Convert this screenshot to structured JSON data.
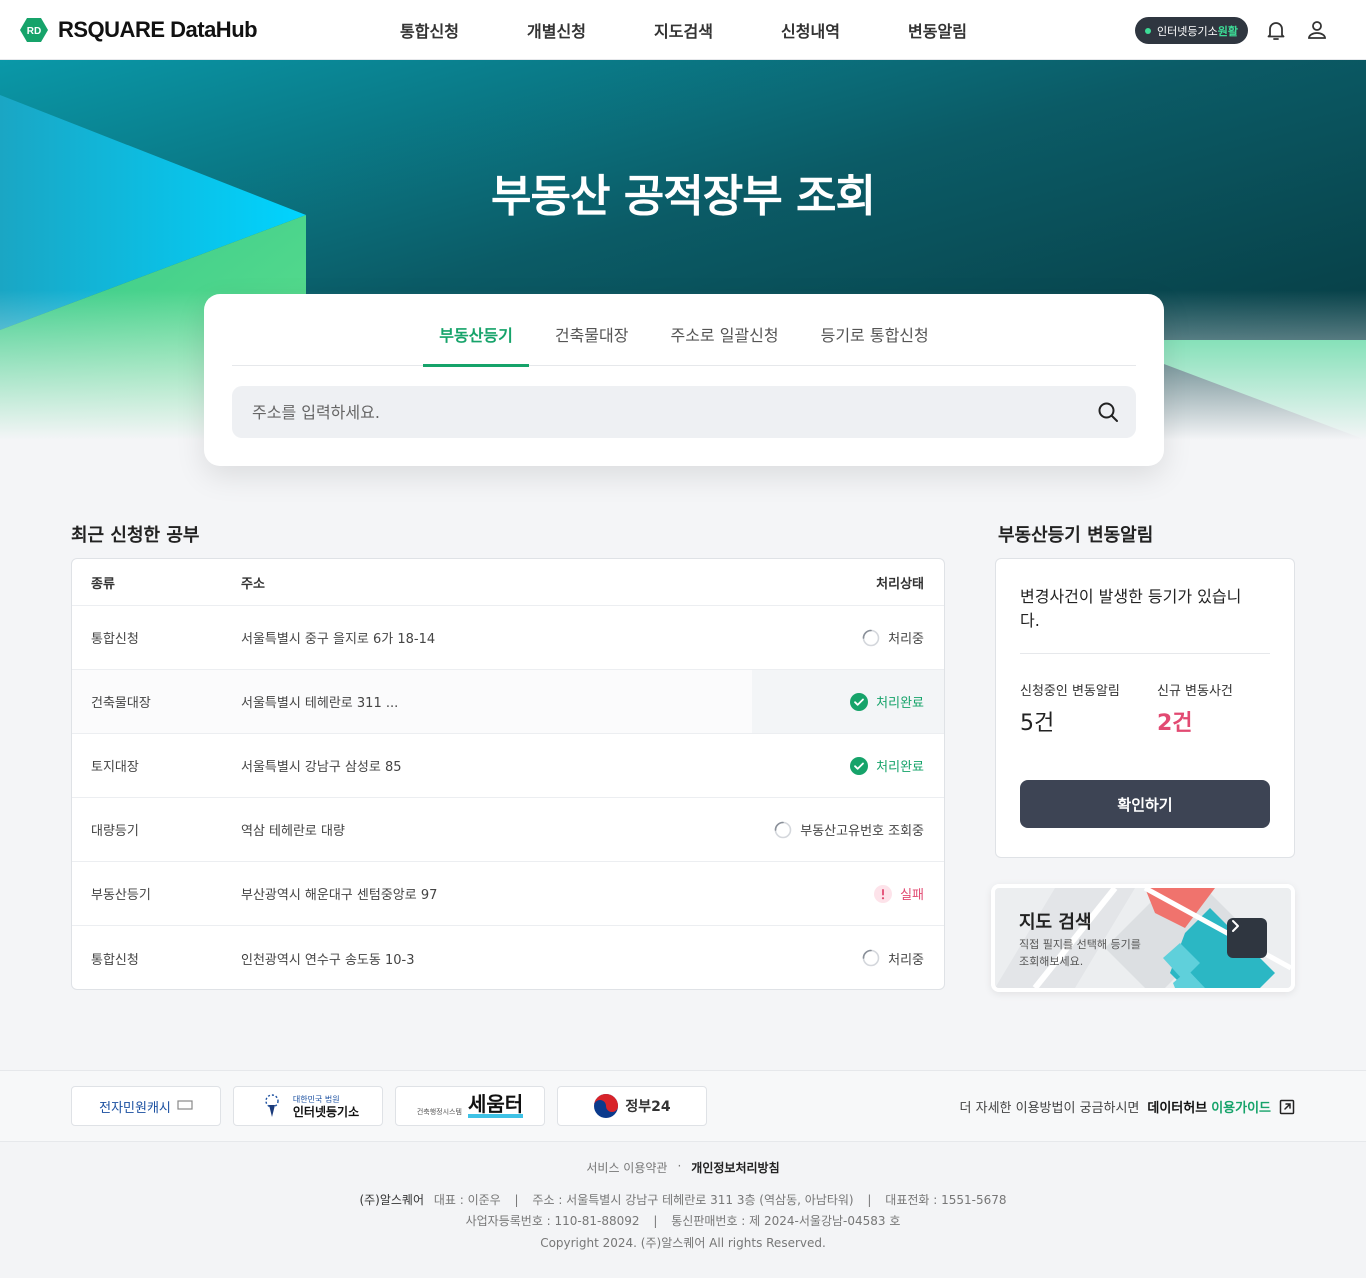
{
  "header": {
    "logo_text": "RSQUARE DataHub",
    "logo_badge": "RD",
    "nav": [
      "통합신청",
      "개별신청",
      "지도검색",
      "신청내역",
      "변동알림"
    ],
    "status_label": "인터넷등기소",
    "status_value": "원활"
  },
  "hero": {
    "title": "부동산 공적장부 조회"
  },
  "search": {
    "tabs": [
      "부동산등기",
      "건축물대장",
      "주소로 일괄신청",
      "등기로 통합신청"
    ],
    "active_tab": "부동산등기",
    "placeholder": "주소를 입력하세요."
  },
  "recent": {
    "title": "최근 신청한 공부",
    "headers": {
      "type": "종류",
      "address": "주소",
      "status": "처리상태"
    },
    "rows": [
      {
        "type": "통합신청",
        "address": "서울특별시 중구 을지로 6가 18-14",
        "status": "처리중",
        "state": "progress"
      },
      {
        "type": "건축물대장",
        "address": "서울특별시 테헤란로 311 ...",
        "status": "처리완료",
        "state": "done"
      },
      {
        "type": "토지대장",
        "address": "서울특별시 강남구 삼성로 85",
        "status": "처리완료",
        "state": "done"
      },
      {
        "type": "대량등기",
        "address": "역삼 테헤란로 대량",
        "status": "부동산고유번호 조회중",
        "state": "progress"
      },
      {
        "type": "부동산등기",
        "address": "부산광역시 해운대구 센텀중앙로 97",
        "status": "실패",
        "state": "fail"
      },
      {
        "type": "통합신청",
        "address": "인천광역시 연수구 송도동 10-3",
        "status": "처리중",
        "state": "progress"
      }
    ]
  },
  "alerts": {
    "title": "부동산등기 변동알림",
    "message": "변경사건이 발생한 등기가 있습니다.",
    "pending_label": "신청중인 변동알림",
    "pending_value": "5건",
    "new_label": "신규 변동사건",
    "new_value": "2건",
    "confirm": "확인하기"
  },
  "map_card": {
    "title": "지도 검색",
    "desc": "직접 필지를 선택해 등기를 조회해보세요."
  },
  "partners": {
    "minwon": "전자민원캐시",
    "iros_small": "대한민국 법원",
    "iros": "인터넷등기소",
    "seumter": "세움터",
    "seumter_small": "건축행정시스템",
    "gov24": "정부24",
    "guide_text": "더 자세한 이용방법이 궁금하시면",
    "guide_strong": "데이터허브",
    "guide_link": "이용가이드"
  },
  "footer": {
    "terms": "서비스 이용약관",
    "sep": "·",
    "privacy": "개인정보처리방침",
    "company": "(주)알스퀘어",
    "ceo": "대표 : 이준우",
    "address": "주소 : 서울특별시 강남구 테헤란로 311 3층 (역삼동, 아남타워)",
    "phone": "대표전화 : 1551-5678",
    "bizno": "사업자등록번호 : 110-81-88092",
    "mailorder": "통신판매번호 : 제 2024-서울강남-04583 호",
    "copyright": "Copyright 2024. (주)알스퀘어 All rights Reserved."
  },
  "colors": {
    "accent": "#16a36a",
    "fail": "#e24a72",
    "dark": "#3d4454",
    "teal": "#0a8ea0"
  }
}
